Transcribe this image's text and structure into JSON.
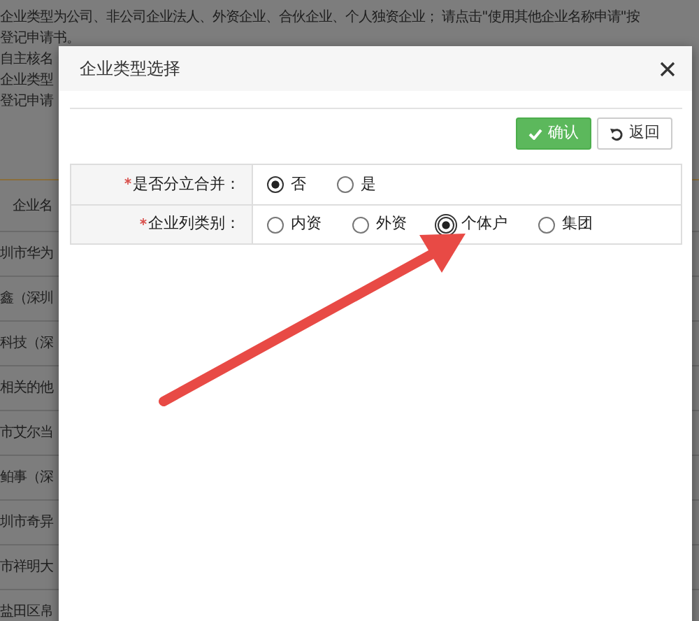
{
  "background_page": {
    "notice_lines": [
      {
        "text": "企业类型为公司、非公司企业法人、外资企业、合伙企业、个人独资企业； 请点击\"使用其他企业名称申请\"按"
      },
      {
        "text": "登记申请书。"
      },
      {
        "text": "自主核名"
      },
      {
        "text": "企业类型"
      },
      {
        "text": "登记申请"
      }
    ],
    "table": {
      "columns": [
        "企业名"
      ],
      "rows": [
        "圳市华为",
        "鑫（深圳",
        "科技（深",
        "相关的他",
        "市艾尔当",
        "鲌事（深",
        "圳市奇异",
        "市祥明大",
        "盐田区帛"
      ]
    }
  },
  "dialog": {
    "title": "企业类型选择",
    "buttons": [
      {
        "label": "确认",
        "kind": "confirm"
      },
      {
        "label": "返回",
        "kind": "back"
      }
    ],
    "fields": [
      {
        "label": "是否分立合并：",
        "required": true,
        "options": [
          {
            "label": "否",
            "selected": true,
            "focused": false
          },
          {
            "label": "是",
            "selected": false,
            "focused": false
          }
        ]
      },
      {
        "label": "企业列类别：",
        "required": true,
        "options": [
          {
            "label": "内资",
            "selected": false,
            "focused": false
          },
          {
            "label": "外资",
            "selected": false,
            "focused": false
          },
          {
            "label": "个体户",
            "selected": true,
            "focused": true
          },
          {
            "label": "集团",
            "selected": false,
            "focused": false
          }
        ]
      }
    ]
  }
}
